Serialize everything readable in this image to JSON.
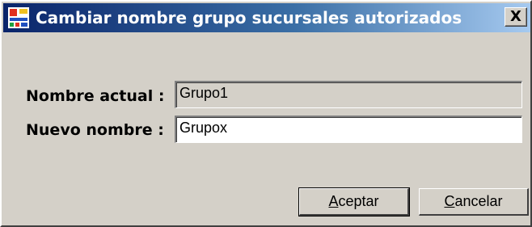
{
  "window": {
    "title": "Cambiar nombre grupo sucursales autorizados",
    "close_glyph": "X",
    "icon": "app-icon"
  },
  "form": {
    "current_name_label": "Nombre actual :",
    "current_name_value": "Grupo1",
    "new_name_label": "Nuevo nombre :",
    "new_name_value": "Grupox"
  },
  "buttons": {
    "accept_mnemonic": "A",
    "accept_rest": "ceptar",
    "cancel_mnemonic": "C",
    "cancel_rest": "ancelar"
  },
  "colors": {
    "title_gradient_start": "#0a246a",
    "title_gradient_end": "#a6caf0",
    "face": "#d4d0c8"
  }
}
